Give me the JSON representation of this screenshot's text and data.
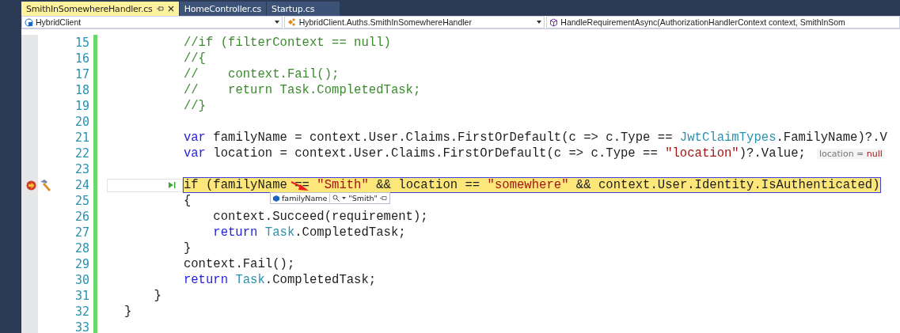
{
  "tabs": [
    {
      "label": "SmithInSomewhereHandler.cs",
      "selected": true
    },
    {
      "label": "HomeController.cs",
      "selected": false
    },
    {
      "label": "Startup.cs",
      "selected": false
    }
  ],
  "navigation_bar": [
    {
      "kind": "project",
      "label": "HybridClient"
    },
    {
      "kind": "class",
      "label": "HybridClient.Auths.SmithInSomewhereHandler"
    },
    {
      "kind": "method",
      "label": "HandleRequirementAsync(AuthorizationHandlerContext context, SmithInSom"
    }
  ],
  "lines": [
    {
      "number": "15",
      "current": false,
      "tokens": [
        {
          "kind": "comment",
          "text": "        //if (filterContext == null)"
        }
      ]
    },
    {
      "number": "16",
      "current": false,
      "tokens": [
        {
          "kind": "comment",
          "text": "        //{"
        }
      ]
    },
    {
      "number": "17",
      "current": false,
      "tokens": [
        {
          "kind": "comment",
          "text": "        //    context.Fail();"
        }
      ]
    },
    {
      "number": "18",
      "current": false,
      "tokens": [
        {
          "kind": "comment",
          "text": "        //    return Task.CompletedTask;"
        }
      ]
    },
    {
      "number": "19",
      "current": false,
      "tokens": [
        {
          "kind": "comment",
          "text": "        //}"
        }
      ]
    },
    {
      "number": "20",
      "current": false
    },
    {
      "number": "21",
      "current": false,
      "tokens": [
        {
          "kind": "keyword",
          "text": "        var"
        },
        {
          "kind": "plain",
          "text": " familyName = context.User.Claims.FirstOrDefault(c => c.Type == "
        },
        {
          "kind": "type",
          "text": "JwtClaimTypes"
        },
        {
          "kind": "plain",
          "text": ".FamilyName)?.V"
        }
      ]
    },
    {
      "number": "22",
      "current": false,
      "tokens": [
        {
          "kind": "keyword",
          "text": "        var"
        },
        {
          "kind": "plain",
          "text": " location = context.User.Claims.FirstOrDefault(c => c.Type == "
        },
        {
          "kind": "string",
          "text": "\"location\""
        },
        {
          "kind": "plain",
          "text": ")?.Value;"
        }
      ],
      "hint": {
        "label": "location =",
        "value": "null"
      }
    },
    {
      "number": "23",
      "current": false
    },
    {
      "number": "24",
      "current": true,
      "tokens": [
        {
          "kind": "plain",
          "text": "        if (familyName == "
        },
        {
          "kind": "string",
          "text": "\"Smith\""
        },
        {
          "kind": "plain",
          "text": " && location == "
        },
        {
          "kind": "string",
          "text": "\"somewhere\""
        },
        {
          "kind": "plain",
          "text": " && context.User.Identity.IsAuthenticated)"
        }
      ],
      "datatip": {
        "name": "familyName",
        "value": "\"Smith\""
      }
    },
    {
      "number": "25",
      "current": false,
      "tokens": [
        {
          "kind": "plain",
          "text": "        {"
        }
      ]
    },
    {
      "number": "26",
      "current": false,
      "tokens": [
        {
          "kind": "plain",
          "text": "            context.Succeed(requirement);"
        }
      ]
    },
    {
      "number": "27",
      "current": false,
      "tokens": [
        {
          "kind": "keyword",
          "text": "            return"
        },
        {
          "kind": "type",
          "text": " Task"
        },
        {
          "kind": "plain",
          "text": ".CompletedTask;"
        }
      ]
    },
    {
      "number": "28",
      "current": false,
      "tokens": [
        {
          "kind": "plain",
          "text": "        }"
        }
      ]
    },
    {
      "number": "29",
      "current": false,
      "tokens": [
        {
          "kind": "plain",
          "text": "        context.Fail();"
        }
      ]
    },
    {
      "number": "30",
      "current": false,
      "tokens": [
        {
          "kind": "keyword",
          "text": "        return"
        },
        {
          "kind": "type",
          "text": " Task"
        },
        {
          "kind": "plain",
          "text": ".CompletedTask;"
        }
      ]
    },
    {
      "number": "31",
      "current": false,
      "tokens": [
        {
          "kind": "plain",
          "text": "    }"
        }
      ]
    },
    {
      "number": "32",
      "current": false,
      "tokens": [
        {
          "kind": "plain",
          "text": "}"
        }
      ]
    },
    {
      "number": "33",
      "current": false
    }
  ]
}
